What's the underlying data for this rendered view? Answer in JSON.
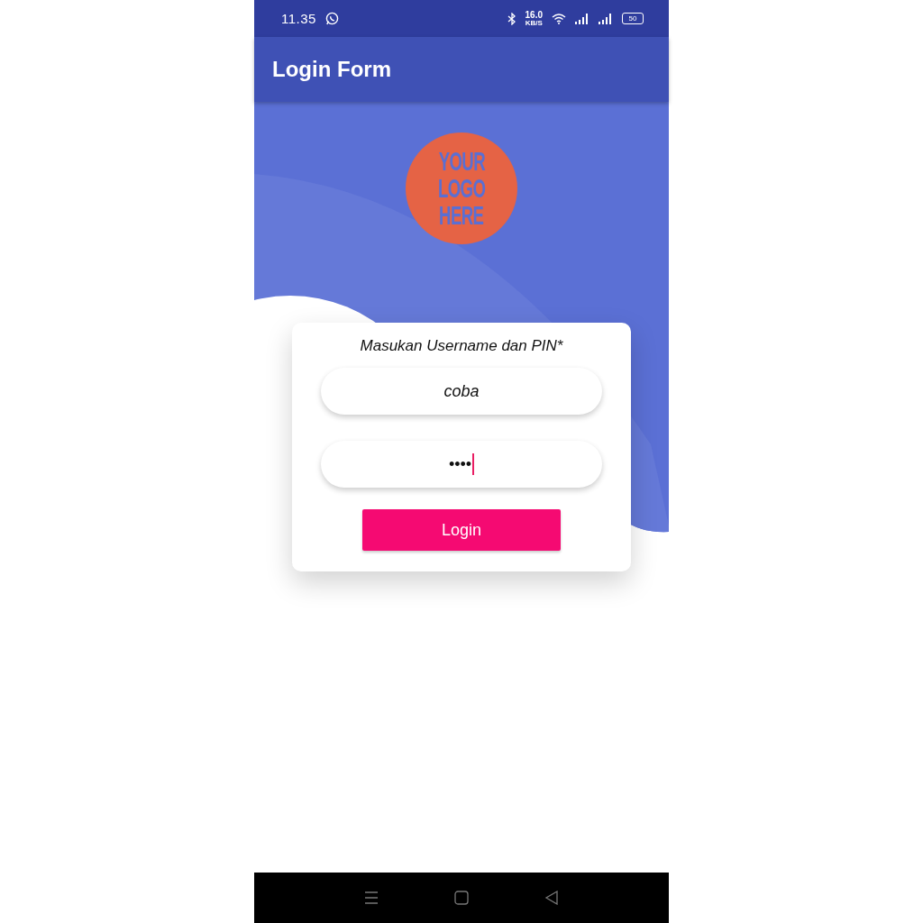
{
  "status_bar": {
    "time": "11.35",
    "speed_value": "16.0",
    "speed_unit": "KB/S",
    "battery": "50"
  },
  "app_bar": {
    "title": "Login Form"
  },
  "logo": {
    "lines": [
      "YOUR",
      "LOGO",
      "HERE"
    ]
  },
  "form": {
    "title": "Masukan Username dan PIN*",
    "fields": [
      {
        "kind": "text",
        "value": "coba",
        "focused": false
      },
      {
        "kind": "password",
        "value": "••••",
        "focused": true
      }
    ],
    "button": "Login"
  }
}
